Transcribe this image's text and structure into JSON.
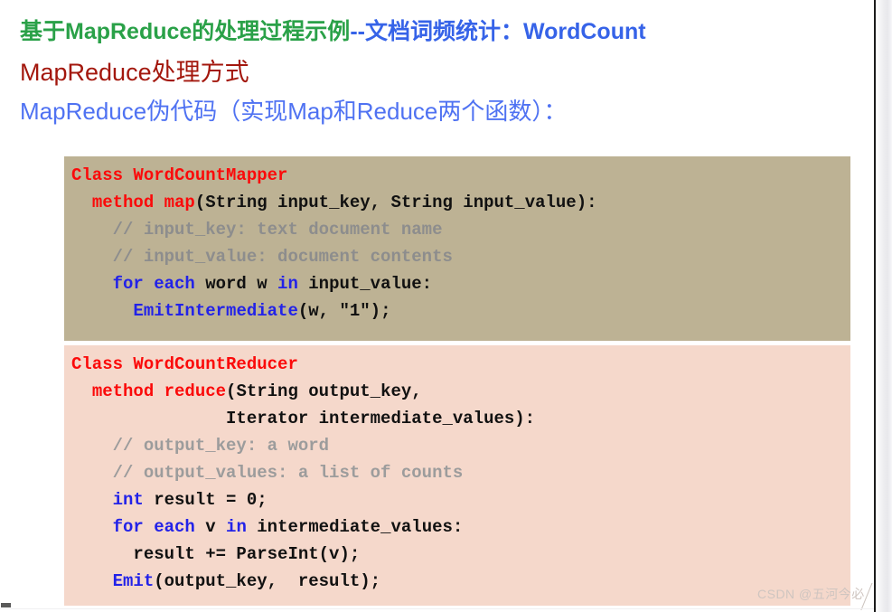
{
  "slide": {
    "top_clipped_text": "",
    "headings": {
      "line1": {
        "green_part": "基于MapReduce的处理过程示例",
        "blue_part": "--文档词频统计：WordCount",
        "green_color": "#2aa148",
        "blue_color": "#3663e8"
      },
      "line2": {
        "text": "MapReduce处理方式",
        "color": "#a3170d"
      },
      "line3": {
        "text": "MapReduce伪代码（实现Map和Reduce两个函数）：",
        "color": "#4f72f2"
      }
    }
  },
  "code_blocks": [
    {
      "name": "mapper",
      "background": "#bdb294",
      "lines": [
        [
          {
            "t": "Class WordCountMapper",
            "c": "red"
          }
        ],
        [
          {
            "t": "  ",
            "c": "black"
          },
          {
            "t": "method map",
            "c": "red"
          },
          {
            "t": "(String input_key, String input_value):",
            "c": "black"
          }
        ],
        [
          {
            "t": "    // input_key: text document name",
            "c": "comment"
          }
        ],
        [
          {
            "t": "    // input_value: document contents",
            "c": "comment"
          }
        ],
        [
          {
            "t": "    ",
            "c": "black"
          },
          {
            "t": "for each",
            "c": "blue"
          },
          {
            "t": " word w ",
            "c": "black"
          },
          {
            "t": "in",
            "c": "blue"
          },
          {
            "t": " input_value:",
            "c": "black"
          }
        ],
        [
          {
            "t": "      ",
            "c": "black"
          },
          {
            "t": "EmitIntermediate",
            "c": "blue"
          },
          {
            "t": "(w, \"1\");",
            "c": "black"
          }
        ]
      ]
    },
    {
      "name": "reducer",
      "background": "#f5d8cb",
      "lines": [
        [
          {
            "t": "Class WordCountReducer",
            "c": "red"
          }
        ],
        [
          {
            "t": "  ",
            "c": "black"
          },
          {
            "t": "method reduce",
            "c": "red"
          },
          {
            "t": "(String output_key,",
            "c": "black"
          }
        ],
        [
          {
            "t": "               Iterator intermediate_values):",
            "c": "black"
          }
        ],
        [
          {
            "t": "    // output_key: a word",
            "c": "comment"
          }
        ],
        [
          {
            "t": "    // output_values: a list of counts",
            "c": "comment"
          }
        ],
        [
          {
            "t": "    ",
            "c": "black"
          },
          {
            "t": "int",
            "c": "blue"
          },
          {
            "t": " result = 0;",
            "c": "black"
          }
        ],
        [
          {
            "t": "    ",
            "c": "black"
          },
          {
            "t": "for each",
            "c": "blue"
          },
          {
            "t": " v ",
            "c": "black"
          },
          {
            "t": "in",
            "c": "blue"
          },
          {
            "t": " intermediate_values:",
            "c": "black"
          }
        ],
        [
          {
            "t": "      result += ParseInt(v);",
            "c": "black"
          }
        ],
        [
          {
            "t": "    ",
            "c": "black"
          },
          {
            "t": "Emit",
            "c": "blue"
          },
          {
            "t": "(output_key,  result);",
            "c": "black"
          }
        ]
      ]
    }
  ],
  "watermark": {
    "text": "CSDN @五河今必"
  }
}
